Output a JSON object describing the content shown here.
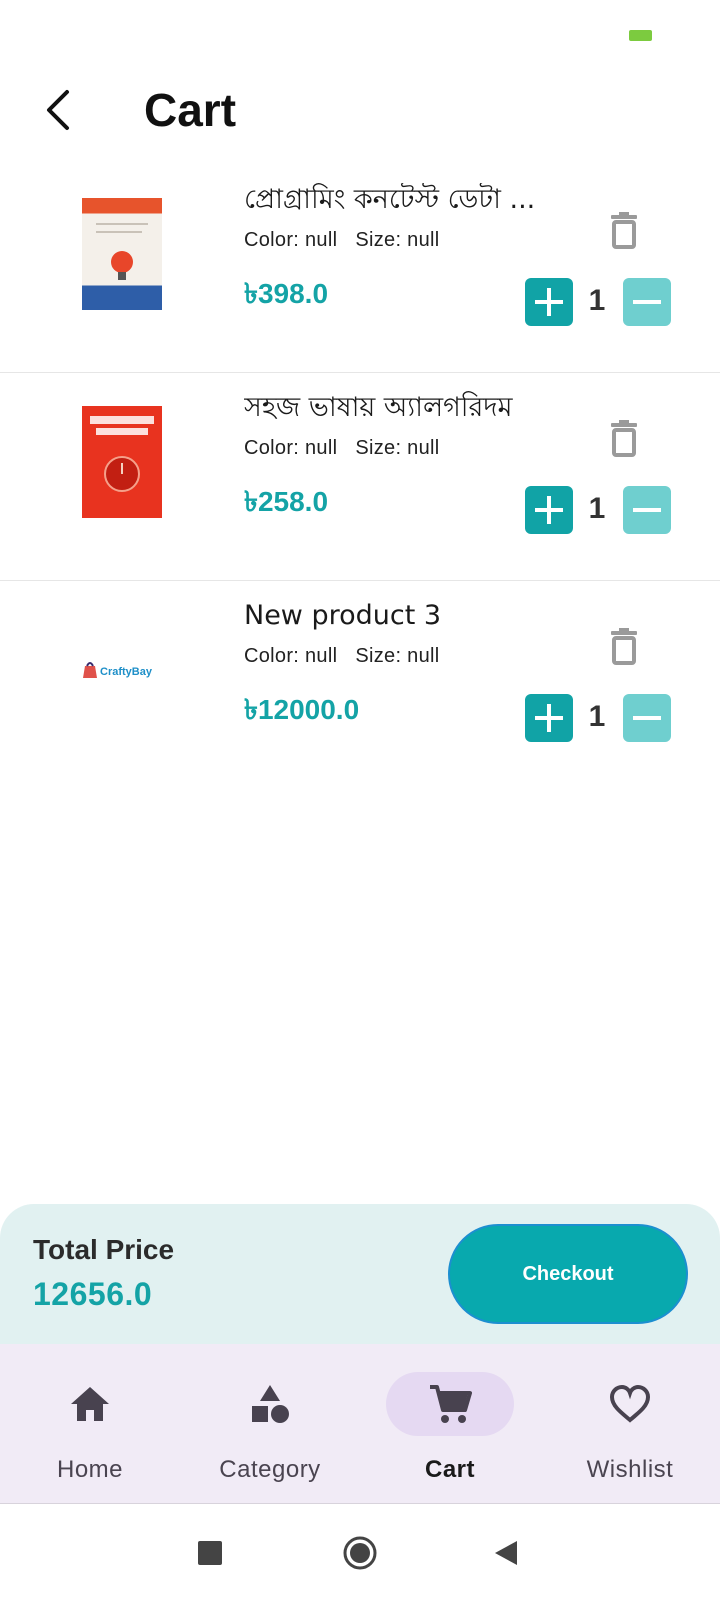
{
  "page": {
    "title": "Cart"
  },
  "cart_items": [
    {
      "name": "প্রোগ্রামিং কনটেস্ট ডেটা ...",
      "color_label": "Color: null",
      "size_label": "Size: null",
      "price": "৳398.0",
      "quantity": "1"
    },
    {
      "name": "সহজ ভাষায় অ্যালগরিদম",
      "color_label": "Color: null",
      "size_label": "Size: null",
      "price": "৳258.0",
      "quantity": "1"
    },
    {
      "name": "New product 3",
      "color_label": "Color: null",
      "size_label": "Size: null",
      "price": "৳12000.0",
      "quantity": "1"
    }
  ],
  "summary": {
    "total_label": "Total Price",
    "total_value": "12656.0",
    "checkout_label": "Checkout"
  },
  "nav": [
    {
      "label": "Home",
      "icon": "home-icon"
    },
    {
      "label": "Category",
      "icon": "category-icon"
    },
    {
      "label": "Cart",
      "icon": "cart-icon",
      "active": true
    },
    {
      "label": "Wishlist",
      "icon": "heart-icon"
    }
  ],
  "logo_text": "CraftyBay",
  "colors": {
    "accent": "#11a3a6",
    "accent_light": "#6fcfcf",
    "price": "#14a3a6",
    "nav_bg": "#f1ebf6",
    "nav_active": "#e5d9f2",
    "total_panel": "#e1f1f1"
  }
}
